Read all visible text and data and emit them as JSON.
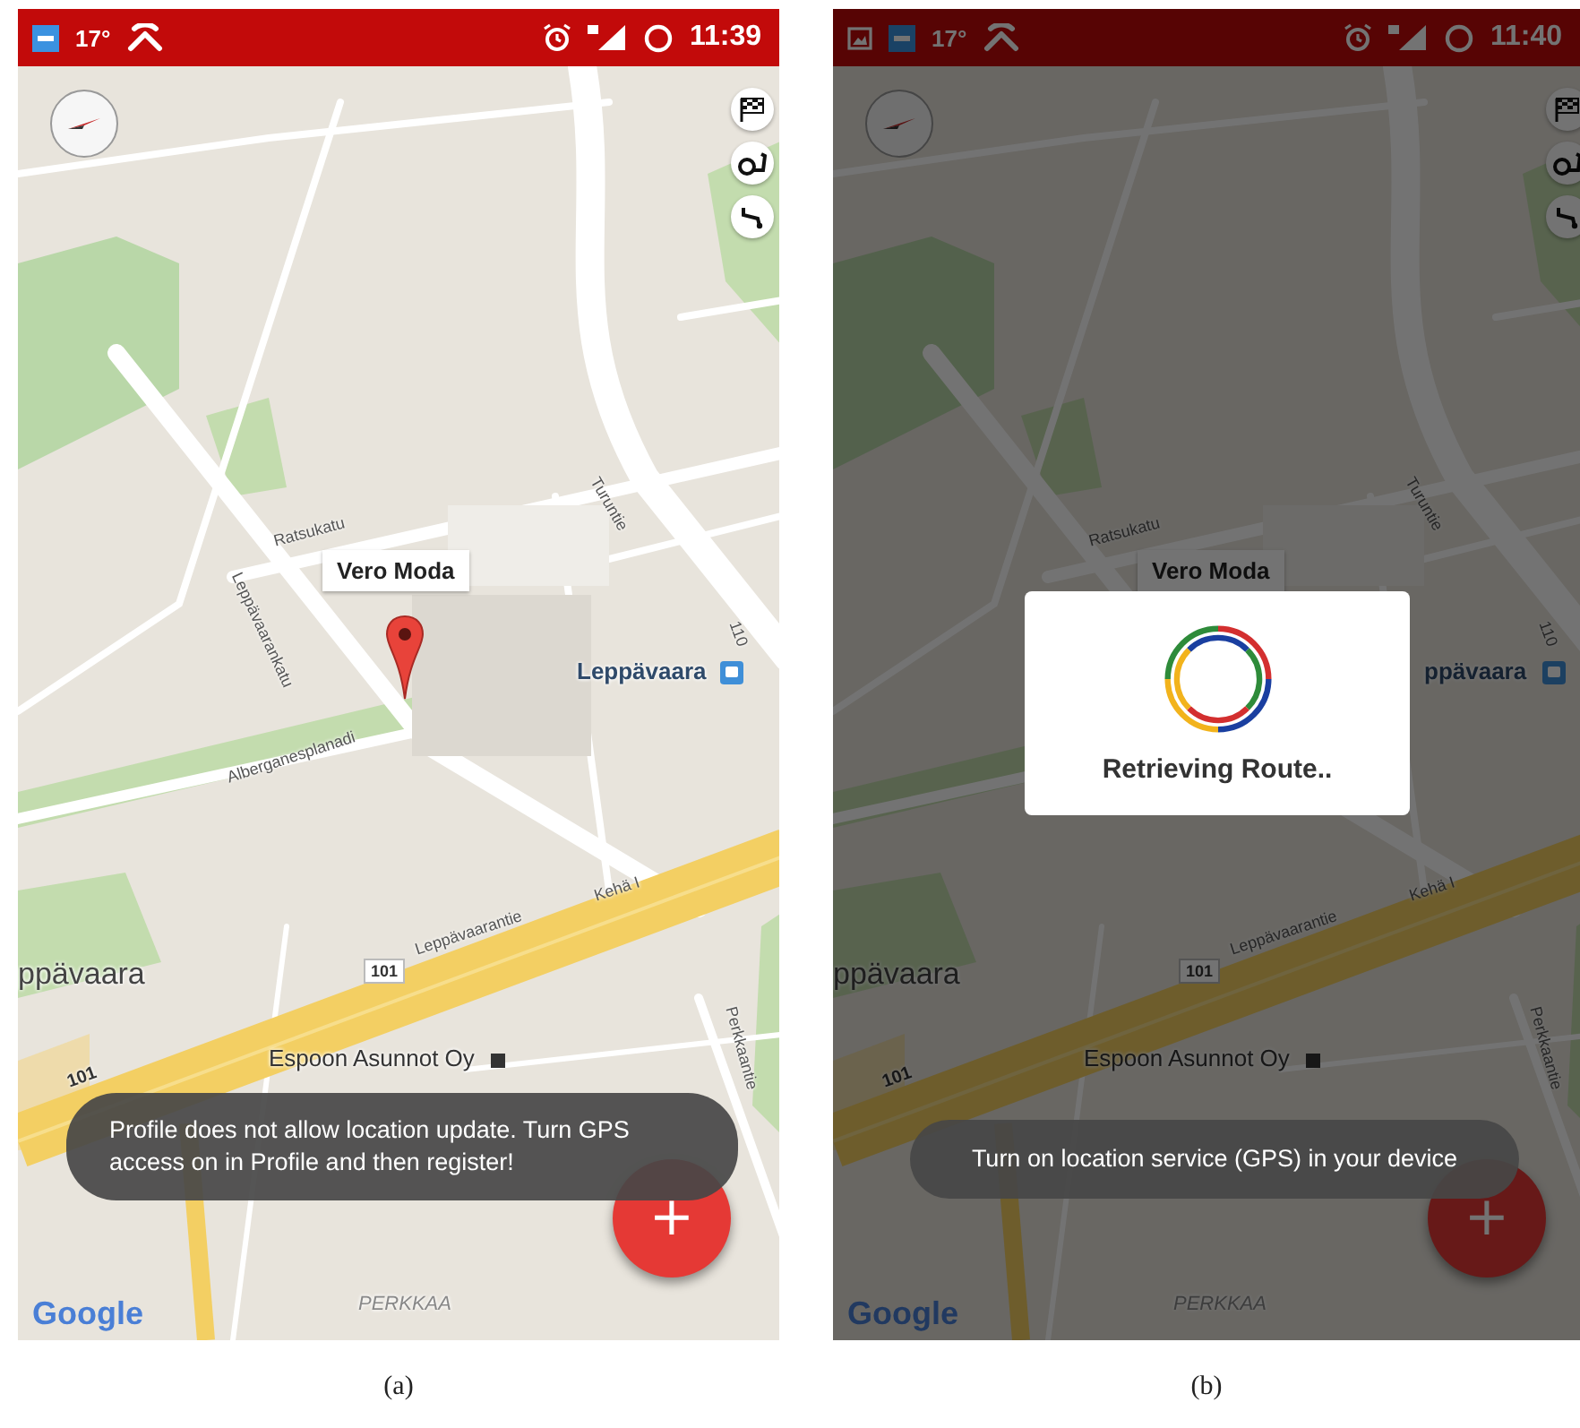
{
  "panels": [
    {
      "caption": "(a)",
      "status_bar": {
        "temperature": "17°",
        "time": "11:39"
      },
      "map_labels": [
        {
          "kind": "callout",
          "text": "Vero Moda"
        },
        {
          "kind": "station",
          "text": "Leppävaara"
        },
        {
          "kind": "street",
          "text": "Ratsukatu"
        },
        {
          "kind": "street",
          "text": "Leppävaarankatu"
        },
        {
          "kind": "street",
          "text": "Alberganesplanadi"
        },
        {
          "kind": "street",
          "text": "Turuntie"
        },
        {
          "kind": "street",
          "text": "110"
        },
        {
          "kind": "place",
          "text": "ppävaara"
        },
        {
          "kind": "road_number",
          "text": "101"
        },
        {
          "kind": "street",
          "text": "Leppävaarantie"
        },
        {
          "kind": "street",
          "text": "Kehä I"
        },
        {
          "kind": "road_label",
          "text": "101"
        },
        {
          "kind": "poi",
          "text": "Espoon Asunnot Oy"
        },
        {
          "kind": "street",
          "text": "Perkkaantie"
        },
        {
          "kind": "district",
          "text": "PERKKAA"
        },
        {
          "kind": "logo",
          "text": "Google"
        }
      ],
      "toast": {
        "text": "Profile does not allow location update. Turn GPS access on in Profile and then register!"
      },
      "fab": {
        "label": "+"
      }
    },
    {
      "caption": "(b)",
      "dimmed": true,
      "status_bar": {
        "gallery_icon": true,
        "temperature": "17°",
        "time": "11:40"
      },
      "map_labels": [
        {
          "kind": "callout",
          "text": "Vero Moda"
        },
        {
          "kind": "station",
          "text": "ppävaara"
        },
        {
          "kind": "street",
          "text": "Ratsukatu"
        },
        {
          "kind": "street",
          "text": "Turuntie"
        },
        {
          "kind": "street",
          "text": "110"
        },
        {
          "kind": "place",
          "text": "ppävaara"
        },
        {
          "kind": "road_number",
          "text": "101"
        },
        {
          "kind": "street",
          "text": "Leppävaarantie"
        },
        {
          "kind": "street",
          "text": "Kehä I"
        },
        {
          "kind": "road_label",
          "text": "101"
        },
        {
          "kind": "poi",
          "text": "Espoon Asunnot Oy"
        },
        {
          "kind": "street",
          "text": "Perkkaantie"
        },
        {
          "kind": "district",
          "text": "PERKKAA"
        },
        {
          "kind": "logo",
          "text": "Google"
        }
      ],
      "dialog": {
        "text": "Retrieving Route.."
      },
      "toast": {
        "text": "Turn on location service (GPS) in your device"
      },
      "fab": {
        "label": "+"
      }
    }
  ]
}
